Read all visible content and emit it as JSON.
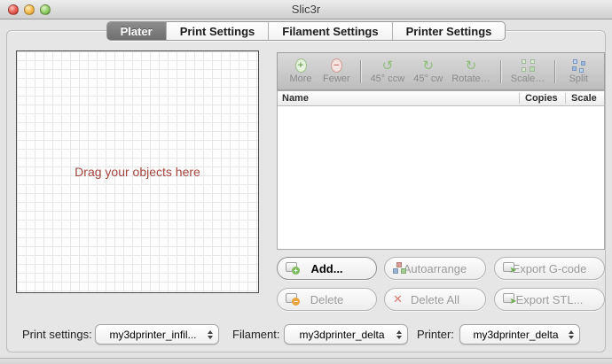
{
  "window": {
    "title": "Slic3r"
  },
  "tabs": [
    {
      "label": "Plater",
      "selected": true
    },
    {
      "label": "Print Settings",
      "selected": false
    },
    {
      "label": "Filament Settings",
      "selected": false
    },
    {
      "label": "Printer Settings",
      "selected": false
    }
  ],
  "plater": {
    "drag_hint": "Drag your objects here",
    "hint_color": "#a3453e"
  },
  "toolbar": {
    "items": [
      {
        "label": "More",
        "icon": "add-copy-icon"
      },
      {
        "label": "Fewer",
        "icon": "remove-copy-icon"
      },
      {
        "label": "45° ccw",
        "icon": "rotate-ccw-icon"
      },
      {
        "label": "45° cw",
        "icon": "rotate-cw-icon"
      },
      {
        "label": "Rotate…",
        "icon": "rotate-icon"
      },
      {
        "label": "Scale…",
        "icon": "scale-icon"
      },
      {
        "label": "Split",
        "icon": "split-icon"
      }
    ]
  },
  "object_list": {
    "columns": [
      "Name",
      "Copies",
      "Scale"
    ],
    "rows": []
  },
  "actions": {
    "add": "Add...",
    "autoarrange": "Autoarrange",
    "export_gcode": "Export G-code",
    "delete": "Delete",
    "delete_all": "Delete All",
    "export_stl": "Export STL..."
  },
  "settings_bar": {
    "print_settings": {
      "label": "Print settings:",
      "value": "my3dprinter_infil..."
    },
    "filament": {
      "label": "Filament:",
      "value": "my3dprinter_delta"
    },
    "printer": {
      "label": "Printer:",
      "value": "my3dprinter_delta"
    }
  },
  "icons": {
    "rotate_ccw_glyph": "↺",
    "rotate_cw_glyph": "↻",
    "delete_all_glyph": "✕",
    "export_arrow_glyph": "➤"
  },
  "colors": {
    "accent_green": "#7cbb5d",
    "accent_red": "#dd7b74",
    "accent_blue": "#7e97bd",
    "hint_text": "#a3453e",
    "selected_tab": "#767676"
  }
}
